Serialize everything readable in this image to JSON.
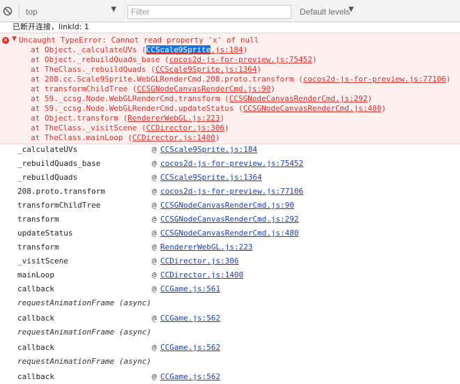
{
  "toolbar": {
    "context": "top",
    "filter_placeholder": "Filter",
    "levels": "Default levels"
  },
  "info_message": "已断开连接，linkId: 1",
  "error": {
    "header": "Uncaught TypeError: Cannot read property 'x' of null",
    "stack": [
      {
        "at": "at Object._calculateUVs (",
        "link": "CCScale9Sprite.js:184",
        "close": ")"
      },
      {
        "at": "at Object._rebuildQuads_base (",
        "link": "cocos2d-js-for-preview.js:75452",
        "close": ")"
      },
      {
        "at": "at TheClass._rebuildQuads (",
        "link": "CCScale9Sprite.js:1364",
        "close": ")"
      },
      {
        "at": "at 208.cc.Scale9Sprite.WebGLRenderCmd.208.proto.transform (",
        "link": "cocos2d-js-for-preview.js:77106",
        "close": ")"
      },
      {
        "at": "at transformChildTree (",
        "link": "CCSGNodeCanvasRenderCmd.js:90",
        "close": ")"
      },
      {
        "at": "at 59._ccsg.Node.WebGLRenderCmd.transform (",
        "link": "CCSGNodeCanvasRenderCmd.js:292",
        "close": ")"
      },
      {
        "at": "at 59._ccsg.Node.WebGLRenderCmd.updateStatus (",
        "link": "CCSGNodeCanvasRenderCmd.js:480",
        "close": ")"
      },
      {
        "at": "at Object.transform (",
        "link": "RendererWebGL.js:223",
        "close": ")"
      },
      {
        "at": "at TheClass._visitScene (",
        "link": "CCDirector.js:306",
        "close": ")"
      },
      {
        "at": "at TheClass.mainLoop (",
        "link": "CCDirector.js:1400",
        "close": ")"
      }
    ]
  },
  "call_stack": [
    {
      "name": "_calculateUVs",
      "at": "@",
      "link": "CCScale9Sprite.js:184"
    },
    {
      "name": "_rebuildQuads_base",
      "at": "@",
      "link": "cocos2d-js-for-preview.js:75452"
    },
    {
      "name": "_rebuildQuads",
      "at": "@",
      "link": "CCScale9Sprite.js:1364"
    },
    {
      "name": "208.proto.transform",
      "at": "@",
      "link": "cocos2d-js-for-preview.js:77106"
    },
    {
      "name": "transformChildTree",
      "at": "@",
      "link": "CCSGNodeCanvasRenderCmd.js:90"
    },
    {
      "name": "transform",
      "at": "@",
      "link": "CCSGNodeCanvasRenderCmd.js:292"
    },
    {
      "name": "updateStatus",
      "at": "@",
      "link": "CCSGNodeCanvasRenderCmd.js:480"
    },
    {
      "name": "transform",
      "at": "@",
      "link": "RendererWebGL.js:223"
    },
    {
      "name": "_visitScene",
      "at": "@",
      "link": "CCDirector.js:306"
    },
    {
      "name": "mainLoop",
      "at": "@",
      "link": "CCDirector.js:1400"
    },
    {
      "name": "callback",
      "at": "@",
      "link": "CCGame.js:561"
    },
    {
      "async": "requestAnimationFrame (async)"
    },
    {
      "name": "callback",
      "at": "@",
      "link": "CCGame.js:562"
    },
    {
      "async": "requestAnimationFrame (async)"
    },
    {
      "name": "callback",
      "at": "@",
      "link": "CCGame.js:562"
    },
    {
      "async": "requestAnimationFrame (async)"
    },
    {
      "name": "callback",
      "at": "@",
      "link": "CCGame.js:562"
    }
  ],
  "colors": {
    "error_text": "#e0302b",
    "error_bg": "#fff0f0",
    "link": "#1a3fa8",
    "highlight": "#1a73e8"
  }
}
